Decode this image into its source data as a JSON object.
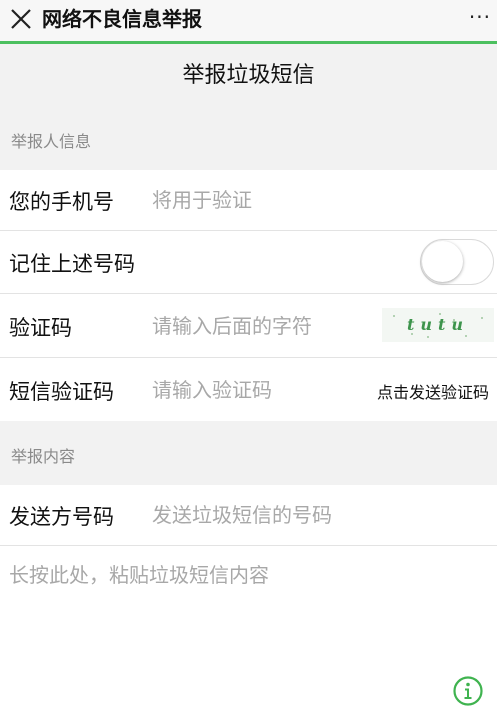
{
  "topbar": {
    "close_icon": "close-icon",
    "title": "网络不良信息举报",
    "more": "···"
  },
  "page": {
    "title": "举报垃圾短信"
  },
  "reporter_section": {
    "label": "举报人信息",
    "phone": {
      "label": "您的手机号",
      "placeholder": "将用于验证",
      "value": ""
    },
    "remember": {
      "label": "记住上述号码",
      "toggle_on": false
    },
    "captcha": {
      "label": "验证码",
      "placeholder": "请输入后面的字符",
      "value": "",
      "image_text": "tutu"
    },
    "sms_code": {
      "label": "短信验证码",
      "placeholder": "请输入验证码",
      "value": "",
      "send_label": "点击发送验证码"
    }
  },
  "content_section": {
    "label": "举报内容",
    "sender": {
      "label": "发送方号码",
      "placeholder": "发送垃圾短信的号码",
      "value": ""
    },
    "message": {
      "placeholder": "长按此处，粘贴垃圾短信内容",
      "value": ""
    }
  },
  "colors": {
    "accent": "#4cc05f",
    "background": "#f2f2f2",
    "placeholder": "#a8a8a8"
  },
  "icons": {
    "info": "info-icon"
  }
}
